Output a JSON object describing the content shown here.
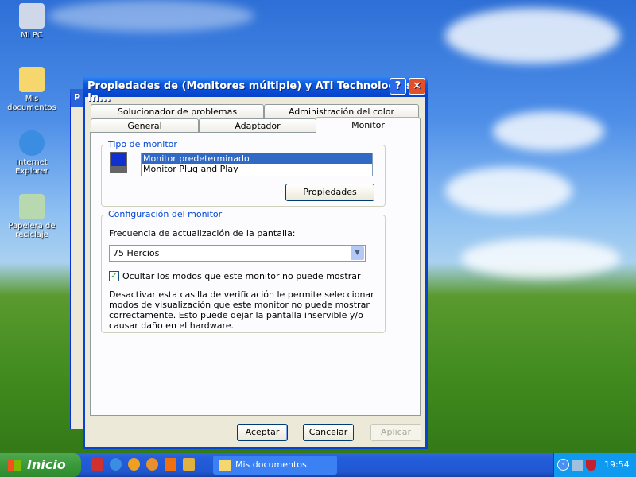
{
  "desktop": {
    "icons": [
      {
        "label": "Mi PC"
      },
      {
        "label": "Mis documentos"
      },
      {
        "label": "Internet Explorer"
      },
      {
        "label": "Papelera de reciclaje"
      }
    ]
  },
  "background_window": {
    "title_initial": "P"
  },
  "dialog": {
    "title": "Propiedades de (Monitores múltiple) y ATI Technologies In...",
    "help_label": "?",
    "close_label": "✕",
    "tabs_row1": [
      "Solucionador de problemas",
      "Administración del color"
    ],
    "tabs_row2": [
      "General",
      "Adaptador",
      "Monitor"
    ],
    "active_tab": "Monitor",
    "monitor_type": {
      "group_label": "Tipo de monitor",
      "items": [
        "Monitor predeterminado",
        "Monitor Plug and Play"
      ],
      "selected": "Monitor predeterminado",
      "properties_button": "Propiedades"
    },
    "monitor_config": {
      "group_label": "Configuración del monitor",
      "refresh_label": "Frecuencia de actualización de la pantalla:",
      "refresh_value": "75 Hercios",
      "hide_modes_label": "Ocultar los modos que este monitor no puede mostrar",
      "hide_modes_checked": true,
      "warning": "Desactivar esta casilla de verificación le permite seleccionar modos de visualización que este monitor no puede mostrar correctamente. Esto puede dejar la pantalla inservible y/o causar daño en el hardware."
    },
    "buttons": {
      "ok": "Aceptar",
      "cancel": "Cancelar",
      "apply": "Aplicar"
    }
  },
  "taskbar": {
    "start_label": "Inicio",
    "task": "Mis documentos",
    "clock": "19:54",
    "quicklaunch": [
      "app-icon",
      "ie-icon",
      "media-player-icon",
      "messenger-icon",
      "office-icon",
      "tool-icon"
    ]
  }
}
